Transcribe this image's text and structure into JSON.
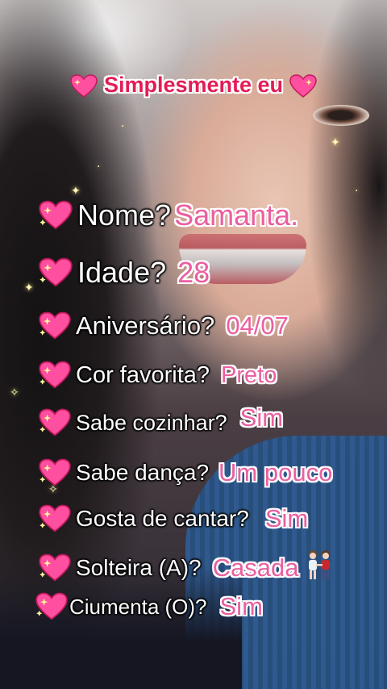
{
  "title": "Simplesmente eu",
  "items": [
    {
      "question": "Nome?",
      "answer": "Samanta."
    },
    {
      "question": "Idade?",
      "answer": "28"
    },
    {
      "question": "Aniversário?",
      "answer": "04/07"
    },
    {
      "question": "Cor favorita?",
      "answer": "Preto"
    },
    {
      "question": "Sabe cozinhar?",
      "answer": "Sim"
    },
    {
      "question": "Sabe dança?",
      "answer": "Um pouco"
    },
    {
      "question": "Gosta de cantar?",
      "answer": "Sim"
    },
    {
      "question": "Solteira (A)?",
      "answer": "Casada"
    },
    {
      "question": "Ciumenta (O)?",
      "answer": "Sim"
    }
  ],
  "icons": {
    "bullet": "sparkling-heart-icon",
    "couple": "couple-holding-hands-icon"
  },
  "colors": {
    "title": "#e21d55",
    "answer": "#ea5fa0",
    "question": "#ffffff"
  }
}
